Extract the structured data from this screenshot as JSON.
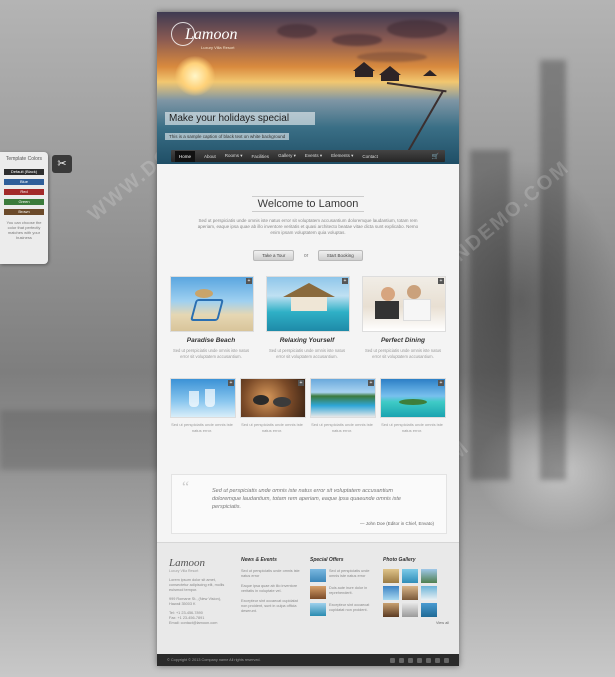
{
  "template_panel": {
    "title": "Template Colors",
    "swatches": [
      {
        "label": "Default (Black)",
        "color": "#2e2e2e"
      },
      {
        "label": "Blue",
        "color": "#2f5f9a"
      },
      {
        "label": "Red",
        "color": "#a32a2a"
      },
      {
        "label": "Green",
        "color": "#3b7b3b"
      },
      {
        "label": "Brown",
        "color": "#6b4a2a"
      }
    ],
    "note": "You can choose the color that perfectly matches with your business"
  },
  "site": {
    "logo": {
      "name": "Lamoon",
      "tagline": "Luxury Villa Resort"
    },
    "hero": {
      "title": "Make your holidays special",
      "subtitle": "This is a sample caption of black text on white background"
    },
    "nav": {
      "items": [
        "Home",
        "About",
        "Rooms ▾",
        "Facilities",
        "Gallery ▾",
        "Events ▾",
        "Elements ▾",
        "Contact"
      ],
      "cart_icon": "cart-icon"
    },
    "welcome": {
      "title": "Welcome to Lamoon",
      "text": "Sed ut perspiciatis unde omnis iste natus error sit voluptatem accusantium doloremque laudantium, totam rem aperiam, eaque ipsa quae ab illo inventore veritatis et quasi architecto beatae vitae dicta sunt explicabo. Nemo enim ipsam voluptatem quia voluptas.",
      "btn_tour": "Take a Tour",
      "or": "or",
      "btn_booking": "Start Booking"
    },
    "features": [
      {
        "title": "Paradise Beach",
        "text": "Sed ut perspiciatis unde omnis iste natus error sit voluptatem accusantium."
      },
      {
        "title": "Relaxing Yourself",
        "text": "Sed ut perspiciatis unde omnis iste natus error sit voluptatem accusantium."
      },
      {
        "title": "Perfect Dining",
        "text": "Sed ut perspiciatis unde omnis iste natus error sit voluptatem accusantium."
      }
    ],
    "small_items": [
      {
        "text": "Sed ut perspiciatis unde omnis iste natus error."
      },
      {
        "text": "Sed ut perspiciatis unde omnis iste natus error."
      },
      {
        "text": "Sed ut perspiciatis unde omnis iste natus error."
      },
      {
        "text": "Sed ut perspiciatis unde omnis iste natus error."
      }
    ],
    "quote": {
      "text": "Sed ut perspiciatis unde omnis iste natus error sit voluptatem accusantium doloremque laudantium, totam rem aperiam, eaque ipsa quaeunde omnis iste perspiciatis.",
      "author": "— John Doe (Editor in Chief, Envato)"
    },
    "footer": {
      "logo": "Lamoon",
      "tagline": "Luxury Villa Resort",
      "about": "Lorem ipsum dolor sit amet, consectetur adipiscing elit, mollis euismod tempor.",
      "address": "999 Romane St., (New Vision), Hawaii 35003 K",
      "phone": "Tel: +1 23-456-7890",
      "fax": "Fax: +1 23-456-7891",
      "email": "Email: contact@lamoon.com",
      "news_head": "News & Events",
      "news": [
        "Sed ut perspiciatis unde omnis iste natus error",
        "Eaque ipsa quae ab illo inventore veritatis in voluptate vel.",
        "Excepteur sint occaecat cupidatat non proident, sunt in culpa officia deserunt."
      ],
      "offers_head": "Special Offers",
      "offers": [
        "Sed ut perspiciatis unde omnis iste natus error",
        "Duis aute irure dolor in reprehenderit.",
        "Excepteur sint occaecat cupidatat non proident."
      ],
      "gallery_head": "Photo Gallery",
      "view_all": "View all"
    },
    "copyright": "© Copyright © 2013 Company name All rights reserved."
  }
}
